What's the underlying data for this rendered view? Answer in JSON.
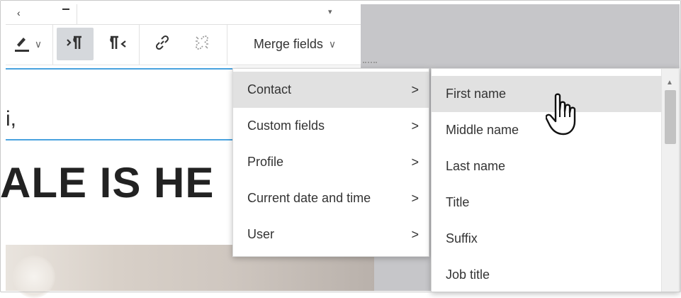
{
  "toolbar": {
    "merge_fields_label": "Merge fields",
    "chevron": "∨",
    "icons": [
      "font-color-icon",
      "ltr-paragraph-icon",
      "rtl-paragraph-icon",
      "link-icon",
      "unlink-icon"
    ]
  },
  "editor": {
    "greeting": "i,",
    "headline": "ALE IS HE"
  },
  "menu": {
    "items": [
      {
        "label": "Contact",
        "selected": true
      },
      {
        "label": "Custom fields"
      },
      {
        "label": "Profile"
      },
      {
        "label": "Current date and time"
      },
      {
        "label": "User"
      }
    ],
    "arrow": ">"
  },
  "submenu": {
    "items": [
      {
        "label": "First name",
        "selected": true
      },
      {
        "label": "Middle name"
      },
      {
        "label": "Last name"
      },
      {
        "label": "Title"
      },
      {
        "label": "Suffix"
      },
      {
        "label": "Job title"
      }
    ]
  },
  "colors": {
    "accent_line": "#4aa3df",
    "menu_hover": "#e1e1e1",
    "toolbar_active": "#d5d8dc",
    "backdrop": "#c6c6c9"
  }
}
